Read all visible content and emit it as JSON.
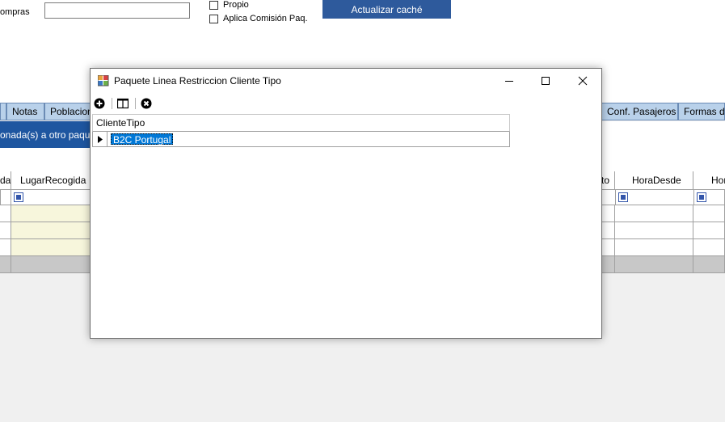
{
  "form": {
    "compras_label": "ompras",
    "propio_label": "Propio",
    "comision_label": "Aplica Comisión Paq.",
    "cache_button": "Actualizar caché"
  },
  "tabs": {
    "notas": "Notas",
    "poblaciones": "Poblaciones",
    "conf_pasajeros": "Conf. Pasajeros",
    "formas": "Formas de"
  },
  "banner": {
    "text": "onada(s) a otro paquete"
  },
  "grid": {
    "col_a": "da",
    "col_lugar": "LugarRecogida",
    "col_to": "to",
    "col_hora_desde": "HoraDesde",
    "col_hor": "Hor"
  },
  "modal": {
    "title": "Paquete Linea Restriccion Cliente Tipo",
    "column_header": "ClienteTipo",
    "rows": [
      {
        "cliente_tipo": "B2C Portugal"
      }
    ]
  },
  "colors": {
    "accent": "#0078d7",
    "button_blue": "#2e5a9c",
    "tab_blue": "#b9d1ea",
    "banner_blue": "#1e56a0",
    "highlight_yellow": "#f7f6dc"
  }
}
